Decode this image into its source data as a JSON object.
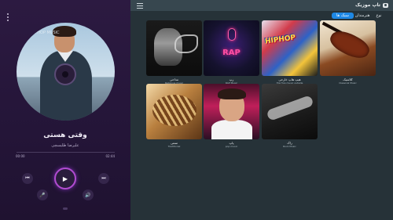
{
  "header": {
    "brand_name": "تاپ موزیک"
  },
  "tabs": [
    {
      "label": "سبک ها",
      "active": true
    },
    {
      "label": "هنرمندان",
      "active": false
    },
    {
      "label": "نوع",
      "active": false
    }
  ],
  "cards": [
    {
      "title": "کلاسیک",
      "subtitle": "Classical Music"
    },
    {
      "title": "هیپ هاپ خارجی",
      "subtitle": "Hip Hop music outside"
    },
    {
      "title": "رپ",
      "subtitle": "RAP Music"
    },
    {
      "title": "مداحی",
      "subtitle": "Religious music"
    },
    {
      "title": "راک",
      "subtitle": "Rock Music"
    },
    {
      "title": "پاپ",
      "subtitle": "pop music"
    },
    {
      "title": "سنتی",
      "subtitle": "Traditional"
    }
  ],
  "cover_art_text": {
    "rap": "RAP",
    "hiphop": "HIPHOP",
    "disc_watermark": "HIPHOP MUSIC"
  },
  "player": {
    "song_title": "وقتی هستی",
    "artist": "علیرضا طلیسچی",
    "time_current": "00:00",
    "time_total": "02:44",
    "progress": 0.0,
    "icons": {
      "menu": "kebab-vertical-icon",
      "prev": "skip-previous-icon",
      "play": "play-icon",
      "next": "skip-next-icon",
      "mic": "microphone-icon",
      "volume": "volume-icon"
    }
  },
  "colors": {
    "accent": "#1e88e5",
    "player_bg": "#2c1a41",
    "content_bg": "#263238",
    "play_ring": "#b14cd0"
  }
}
